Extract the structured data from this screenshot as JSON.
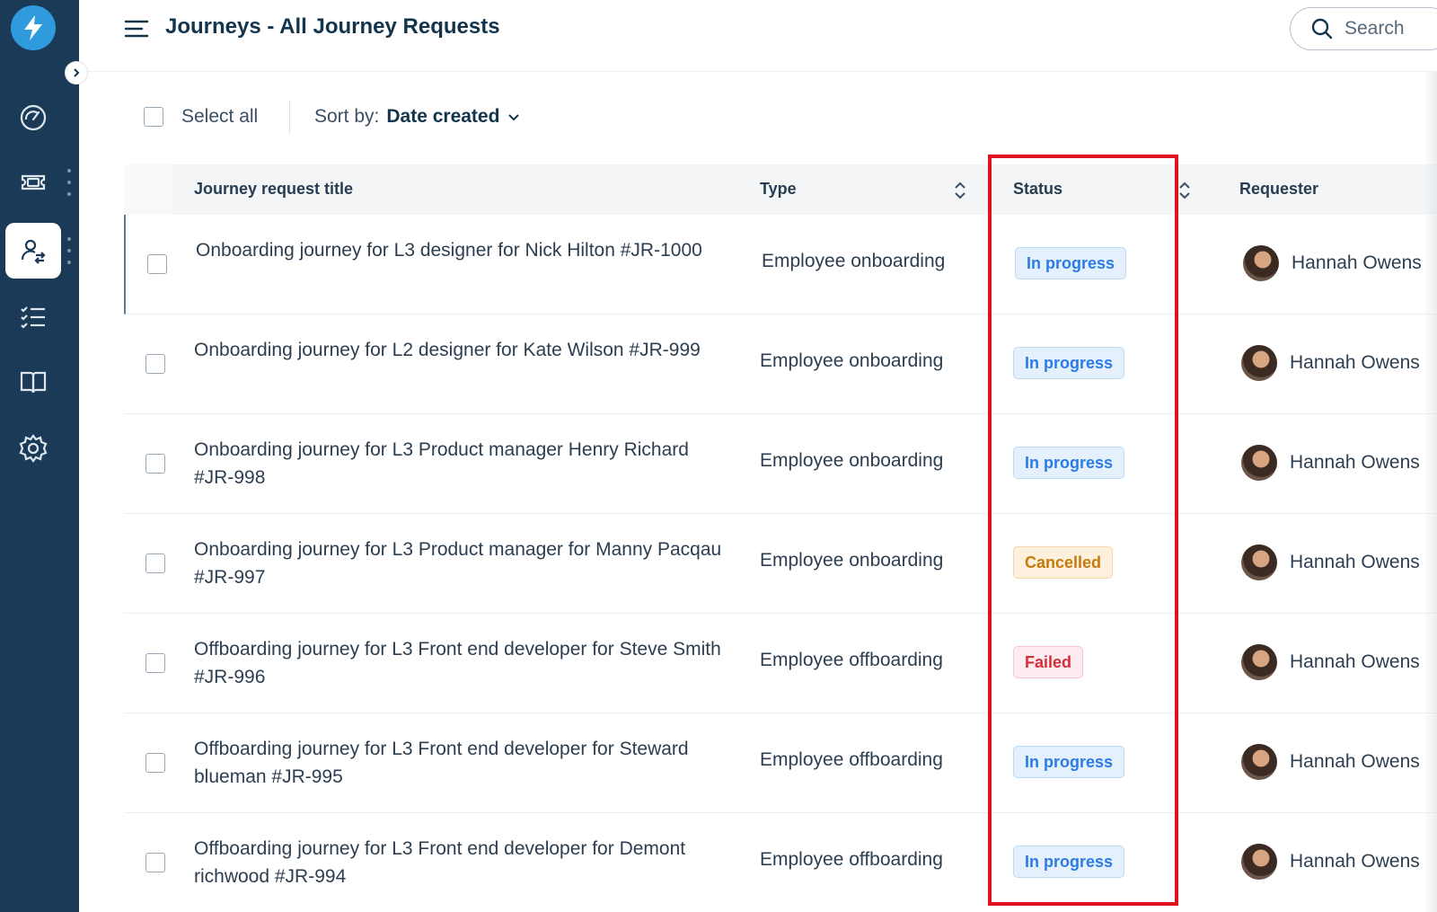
{
  "header": {
    "title": "Journeys - All Journey Requests",
    "search_label": "Search"
  },
  "toolbar": {
    "select_all_label": "Select all",
    "sort_prefix": "Sort by:",
    "sort_value": "Date created"
  },
  "table": {
    "columns": {
      "title": "Journey request title",
      "type": "Type",
      "status": "Status",
      "requester": "Requester"
    },
    "rows": [
      {
        "title": "Onboarding journey for L3 designer for Nick Hilton #JR-1000",
        "type": "Employee onboarding",
        "status": "In progress",
        "status_kind": "in-progress",
        "requester": "Hannah Owens"
      },
      {
        "title": "Onboarding journey for L2 designer for Kate Wilson #JR-999",
        "type": "Employee onboarding",
        "status": "In progress",
        "status_kind": "in-progress",
        "requester": "Hannah Owens"
      },
      {
        "title": "Onboarding journey for L3 Product manager Henry Richard #JR-998",
        "type": "Employee onboarding",
        "status": "In progress",
        "status_kind": "in-progress",
        "requester": "Hannah Owens"
      },
      {
        "title": "Onboarding journey for L3 Product manager for Manny Pacqau #JR-997",
        "type": "Employee onboarding",
        "status": "Cancelled",
        "status_kind": "cancelled",
        "requester": "Hannah Owens"
      },
      {
        "title": "Offboarding journey for L3 Front end developer for Steve Smith #JR-996",
        "type": "Employee offboarding",
        "status": "Failed",
        "status_kind": "failed",
        "requester": "Hannah Owens"
      },
      {
        "title": "Offboarding journey for L3 Front end developer for Steward blueman #JR-995",
        "type": "Employee offboarding",
        "status": "In progress",
        "status_kind": "in-progress",
        "requester": "Hannah Owens"
      },
      {
        "title": "Offboarding journey for L3 Front end developer for Demont richwood #JR-994",
        "type": "Employee offboarding",
        "status": "In progress",
        "status_kind": "in-progress",
        "requester": "Hannah Owens"
      }
    ]
  },
  "sidebar": {
    "items": [
      {
        "icon": "dashboard-gauge-icon",
        "active": false
      },
      {
        "icon": "ticket-icon",
        "active": false
      },
      {
        "icon": "journeys-user-swap-icon",
        "active": true
      },
      {
        "icon": "checklist-icon",
        "active": false
      },
      {
        "icon": "book-icon",
        "active": false
      },
      {
        "icon": "settings-gear-icon",
        "active": false
      }
    ]
  },
  "colors": {
    "sidebar_bg": "#1b3a57",
    "logo_bg": "#2f9bdc",
    "in_progress": "#2c7be5",
    "cancelled": "#c67a0c",
    "failed": "#d72d3b",
    "highlight": "#e0121f"
  }
}
